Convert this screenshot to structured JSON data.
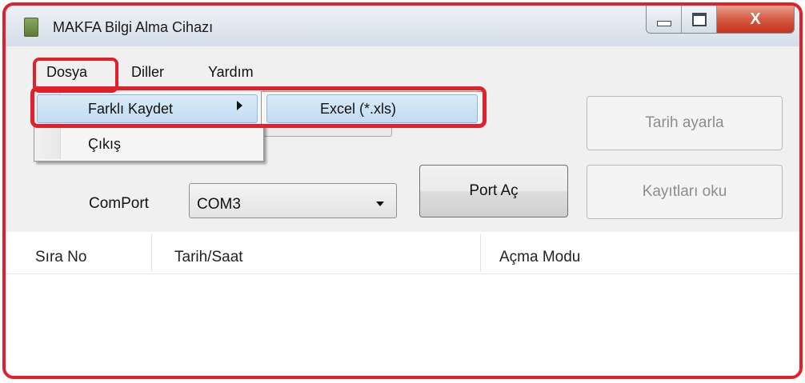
{
  "window": {
    "title": "MAKFA Bilgi Alma Cihazı",
    "close_glyph": "X"
  },
  "menubar": {
    "items": [
      {
        "label": "Dosya"
      },
      {
        "label": "Diller"
      },
      {
        "label": "Yardım"
      }
    ]
  },
  "dosya_menu": {
    "items": [
      {
        "label": "Farklı Kaydet",
        "has_submenu": true,
        "highlighted": true
      },
      {
        "label": "Çıkış"
      }
    ],
    "submenu": {
      "items": [
        {
          "label": "Excel (*.xls)",
          "highlighted": true
        }
      ]
    }
  },
  "controls": {
    "tarih_button": "Tarih ayarla",
    "port_button": "Port Aç",
    "kayit_button": "Kayıtları oku",
    "comport_label": "ComPort",
    "comport_value": "COM3"
  },
  "list": {
    "columns": [
      "Sıra No",
      "Tarih/Saat",
      "Açma Modu"
    ]
  },
  "colors": {
    "annotation": "#e0202a",
    "menu_highlight": "#c2dcf3",
    "close_button": "#d3553c"
  },
  "icons": [
    "app-icon",
    "minimize-icon",
    "maximize-icon",
    "close-icon",
    "submenu-arrow-icon",
    "dropdown-arrow-icon"
  ]
}
